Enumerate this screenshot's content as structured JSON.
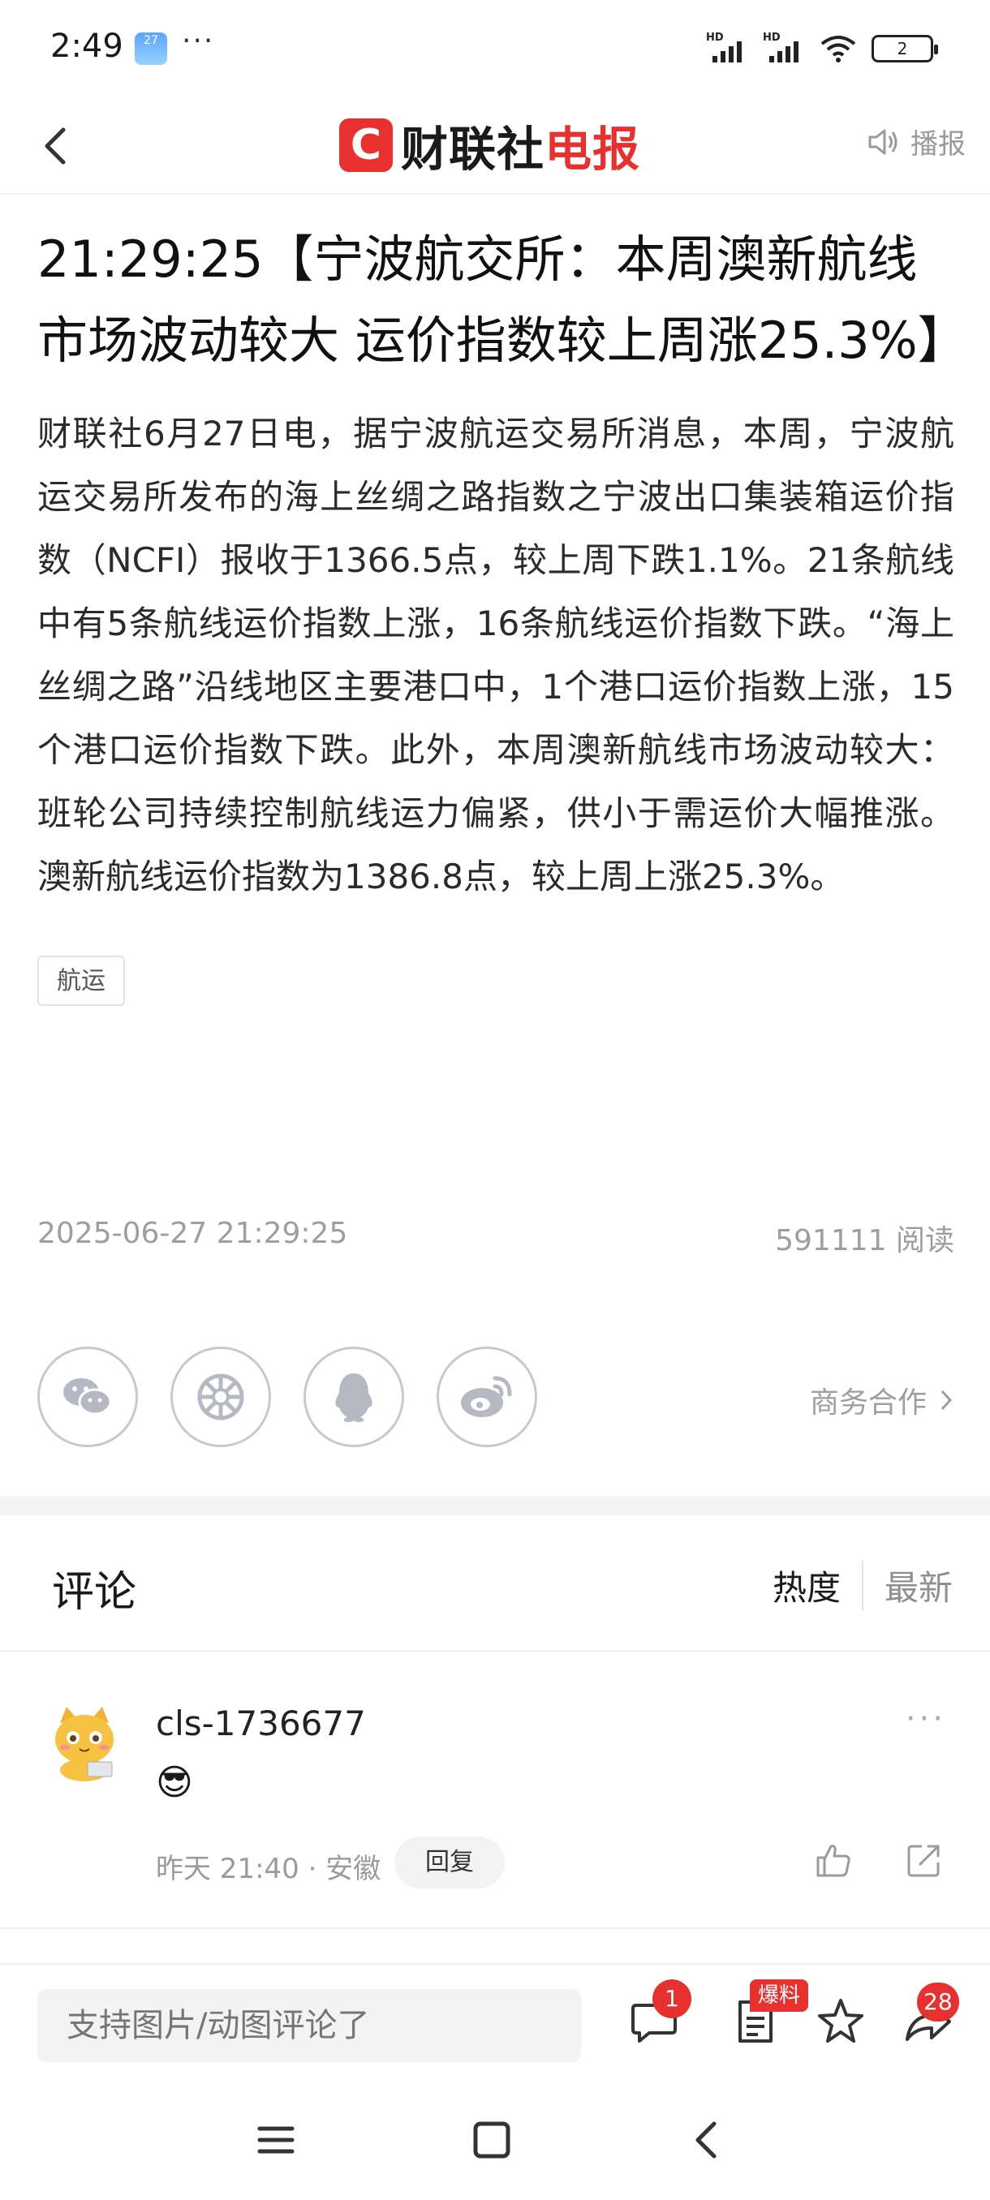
{
  "status_bar": {
    "time": "2:49",
    "weather_badge": "27",
    "more": "···",
    "signal1_label": "HD",
    "signal2_label": "HD",
    "battery": "2"
  },
  "header": {
    "logo_mark": "C",
    "logo_text_black": "财联社",
    "logo_text_red": "电报",
    "broadcast_label": "播报"
  },
  "article": {
    "title": "21:29:25【宁波航交所：本周澳新航线市场波动较大 运价指数较上周涨25.3%】",
    "body": "财联社6月27日电，据宁波航运交易所消息，本周，宁波航运交易所发布的海上丝绸之路指数之宁波出口集装箱运价指数（NCFI）报收于1366.5点，较上周下跌1.1%。21条航线中有5条航线运价指数上涨，16条航线运价指数下跌。“海上丝绸之路”沿线地区主要港口中，1个港口运价指数上涨，15个港口运价指数下跌。此外，本周澳新航线市场波动较大：班轮公司持续控制航线运力偏紧，供小于需运价大幅推涨。澳新航线运价指数为1386.8点，较上周上涨25.3%。",
    "tag": "航运",
    "datetime": "2025-06-27 21:29:25",
    "read_count": "591111 阅读"
  },
  "share": {
    "business_label": "商务合作"
  },
  "comments": {
    "title": "评论",
    "sort_hot": "热度",
    "sort_new": "最新",
    "items": [
      {
        "user": "cls-1736677",
        "content": "😎",
        "meta": "昨天 21:40 · 安徽",
        "reply_label": "回复"
      }
    ]
  },
  "bottom_bar": {
    "input_placeholder": "支持图片/动图评论了",
    "comment_badge": "1",
    "baoliao_label": "爆料",
    "share_badge": "28"
  },
  "colors": {
    "brand_red": "#e8312f",
    "muted_text": "#9e9e9e"
  }
}
